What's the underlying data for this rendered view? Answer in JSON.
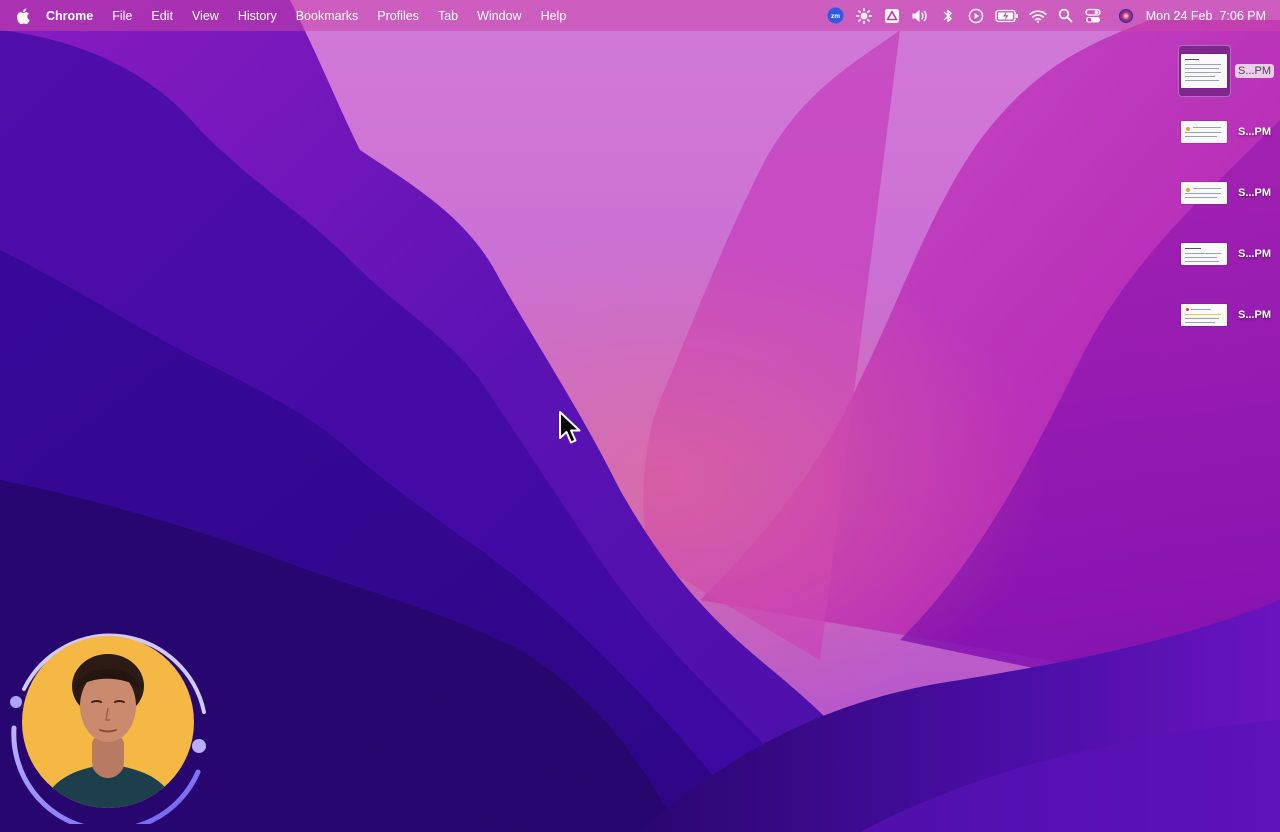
{
  "menubar": {
    "apple_icon": "apple-icon",
    "app_name": "Chrome",
    "menus": [
      "File",
      "Edit",
      "View",
      "History",
      "Bookmarks",
      "Profiles",
      "Tab",
      "Window",
      "Help"
    ],
    "status_icons": [
      {
        "name": "zoom-icon",
        "text": "zm"
      },
      {
        "name": "brightness-icon"
      },
      {
        "name": "drive-icon"
      },
      {
        "name": "volume-icon"
      },
      {
        "name": "bluetooth-icon"
      },
      {
        "name": "play-icon"
      },
      {
        "name": "battery-icon"
      },
      {
        "name": "wifi-icon"
      },
      {
        "name": "spotlight-search-icon"
      },
      {
        "name": "control-center-icon"
      },
      {
        "name": "siri-icon"
      }
    ],
    "clock": {
      "date": "Mon 24 Feb",
      "time": "7:06 PM"
    }
  },
  "desktop": {
    "files": [
      {
        "label": "S...PM",
        "selected": true
      },
      {
        "label": "S...PM",
        "selected": false
      },
      {
        "label": "S...PM",
        "selected": false
      },
      {
        "label": "S...PM",
        "selected": false
      },
      {
        "label": "S...PM",
        "selected": false
      }
    ]
  },
  "cursor": "arrow-cursor",
  "webcam": {
    "name": "webcam-bubble"
  },
  "colors": {
    "accent_ring": "#7d6cf0",
    "webcam_bg": "#f5b845",
    "menubar_bg": "#c846aa"
  }
}
